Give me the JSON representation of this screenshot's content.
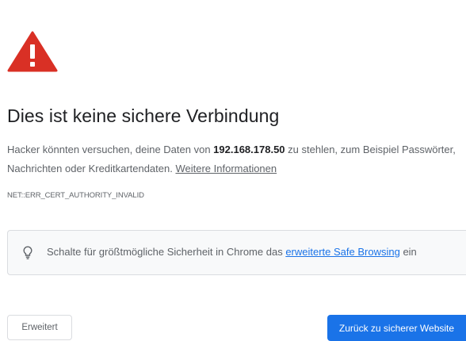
{
  "warning": {
    "icon": "warning-triangle-icon",
    "color": "#d93025"
  },
  "title": "Dies ist keine sichere Verbindung",
  "message": {
    "before_host": "Hacker könnten versuchen, deine Daten von ",
    "host": "192.168.178.50",
    "after_host": " zu stehlen, zum Beispiel Passwörter, Nachrichten oder Kreditkartendaten. ",
    "learn_more": "Weitere Informationen"
  },
  "error_code": "NET::ERR_CERT_AUTHORITY_INVALID",
  "safe_browsing": {
    "icon": "lightbulb-icon",
    "before_link": "Schalte für größtmögliche Sicherheit in Chrome das ",
    "link": "erweiterte Safe Browsing",
    "after_link": " ein"
  },
  "buttons": {
    "advanced": "Erweitert",
    "back": "Zurück zu sicherer Website"
  },
  "colors": {
    "accent": "#1a73e8",
    "text": "#202124",
    "secondary_text": "#5f6368",
    "warning": "#d93025"
  }
}
